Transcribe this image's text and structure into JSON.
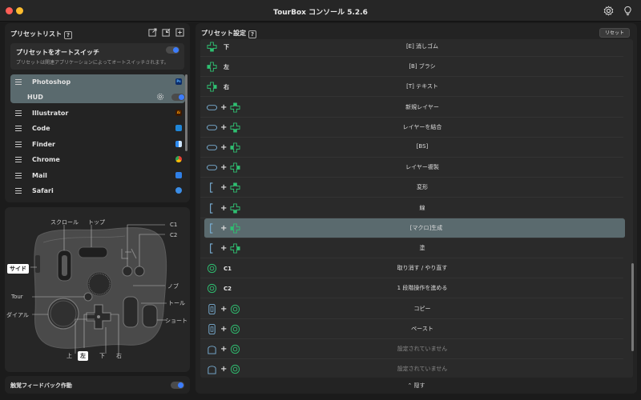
{
  "window": {
    "title": "TourBox コンソール 5.2.6"
  },
  "titlebar_icons": [
    "settings-gear-icon",
    "lightbulb-icon"
  ],
  "preset_list": {
    "title": "プリセットリスト",
    "help": "?",
    "header_icons": [
      "export-icon",
      "import-icon",
      "add-icon"
    ],
    "auto_switch": {
      "label": "プリセットをオートスイッチ",
      "description": "プリセットは関連アプリケーションによってオートスイッチされます。",
      "enabled": true
    },
    "apps": [
      {
        "name": "Photoshop",
        "badge": "Ps",
        "badge_color": "#0c2d6b",
        "selected": true
      },
      {
        "name": "HUD",
        "sub": true,
        "toggle": true
      },
      {
        "name": "Illustrator",
        "badge": "Ai",
        "badge_color": "#3b1a05"
      },
      {
        "name": "Code",
        "badge": "",
        "badge_color": "#1f86d8"
      },
      {
        "name": "Finder",
        "badge": "",
        "badge_color": "#2f8cf0"
      },
      {
        "name": "Chrome",
        "badge": "",
        "badge_color": "#e8a13a"
      },
      {
        "name": "Mail",
        "badge": "",
        "badge_color": "#2f7fe6"
      },
      {
        "name": "Safari",
        "badge": "",
        "badge_color": "#3b8de6"
      }
    ]
  },
  "device_labels": {
    "scroll": "スクロール",
    "top": "トップ",
    "c1": "C1",
    "c2": "C2",
    "side": "サイド",
    "knob": "ノブ",
    "tour": "Tour",
    "tall": "トール",
    "dial": "ダイアル",
    "short": "ショート",
    "up": "上",
    "left": "左",
    "down": "下",
    "right": "右"
  },
  "haptic": {
    "label": "触覚フィードバック作動",
    "enabled": true
  },
  "preset_settings": {
    "title": "プリセット設定",
    "help": "?",
    "reset": "リセット",
    "rows": [
      {
        "icons": [
          "dpad-down"
        ],
        "key": "下",
        "action": "[E] 消しゴム"
      },
      {
        "icons": [
          "dpad-left"
        ],
        "key": "左",
        "action": "[B] ブラシ"
      },
      {
        "icons": [
          "dpad-right"
        ],
        "key": "右",
        "action": "[T] テキスト"
      },
      {
        "icons": [
          "tall",
          "dpad-up"
        ],
        "key": "",
        "action": "新規レイヤー"
      },
      {
        "icons": [
          "tall",
          "dpad-down"
        ],
        "key": "",
        "action": "レイヤーを結合"
      },
      {
        "icons": [
          "tall",
          "dpad-left"
        ],
        "key": "",
        "action": "[BS]"
      },
      {
        "icons": [
          "tall",
          "dpad-right"
        ],
        "key": "",
        "action": "レイヤー複製"
      },
      {
        "icons": [
          "side",
          "dpad-up"
        ],
        "key": "",
        "action": "変形"
      },
      {
        "icons": [
          "side",
          "dpad-down"
        ],
        "key": "",
        "action": "線"
      },
      {
        "icons": [
          "side",
          "dpad-left"
        ],
        "key": "",
        "action": "[マクロ]生成",
        "highlighted": true
      },
      {
        "icons": [
          "side",
          "dpad-right"
        ],
        "key": "",
        "action": "塗"
      },
      {
        "icons": [
          "button-c"
        ],
        "key": "C1",
        "action": "取り消す / やり直す"
      },
      {
        "icons": [
          "button-c"
        ],
        "key": "C2",
        "action": "1 段階操作を進める"
      },
      {
        "icons": [
          "short",
          "button-c"
        ],
        "key": "",
        "action": "コピー"
      },
      {
        "icons": [
          "short",
          "button-c"
        ],
        "key": "",
        "action": "ペースト"
      },
      {
        "icons": [
          "top",
          "button-c"
        ],
        "key": "",
        "action": "設定されていません",
        "unset": true
      },
      {
        "icons": [
          "top",
          "button-c"
        ],
        "key": "",
        "action": "設定されていません",
        "unset": true
      }
    ],
    "hide": "隠す"
  },
  "colors": {
    "accent_green": "#2fbf71",
    "toggle_blue": "#3c7dff",
    "selection": "#5a6a6e"
  }
}
